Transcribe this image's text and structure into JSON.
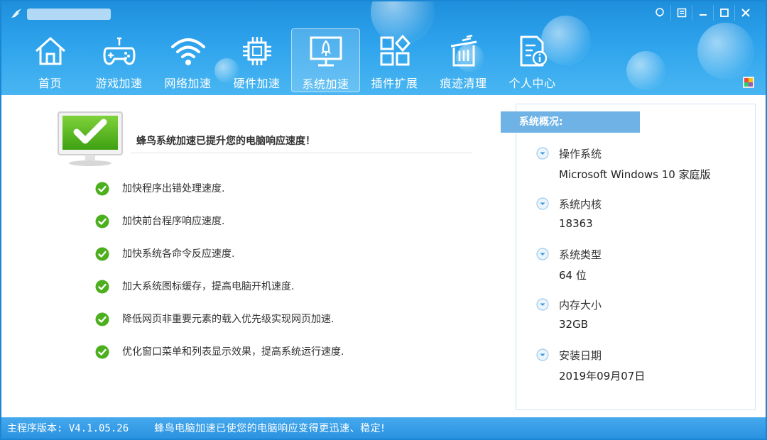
{
  "window": {
    "controls": [
      "feedback-icon",
      "menu-icon",
      "minimize-icon",
      "maximize-icon",
      "close-icon"
    ]
  },
  "nav": {
    "items": [
      {
        "label": "首页",
        "icon": "home-icon"
      },
      {
        "label": "游戏加速",
        "icon": "gamepad-icon"
      },
      {
        "label": "网络加速",
        "icon": "wifi-icon"
      },
      {
        "label": "硬件加速",
        "icon": "chip-icon"
      },
      {
        "label": "系统加速",
        "icon": "rocket-monitor-icon",
        "active": true
      },
      {
        "label": "插件扩展",
        "icon": "plugin-icon"
      },
      {
        "label": "痕迹清理",
        "icon": "trash-icon"
      },
      {
        "label": "个人中心",
        "icon": "profile-document-icon"
      }
    ]
  },
  "main": {
    "headline": "蜂鸟系统加速已提升您的电脑响应速度！",
    "features": [
      "加快程序出错处理速度.",
      "加快前台程序响应速度.",
      "加快系统各命令反应速度.",
      "加大系统图标缓存，提高电脑开机速度.",
      "降低网页非重要元素的载入优先级实现网页加速.",
      "优化窗口菜单和列表显示效果，提高系统运行速度."
    ]
  },
  "system": {
    "title": "系统概况:",
    "items": [
      {
        "label": "操作系统",
        "value": "Microsoft Windows 10 家庭版"
      },
      {
        "label": "系统内核",
        "value": "18363"
      },
      {
        "label": "系统类型",
        "value": "64 位"
      },
      {
        "label": "内存大小",
        "value": "32GB"
      },
      {
        "label": "安装日期",
        "value": "2019年09月07日"
      }
    ]
  },
  "status_bar": {
    "version": "主程序版本: V4.1.05.26",
    "message": "蜂鸟电脑加速已使您的电脑响应变得更迅速、稳定!"
  },
  "colors": {
    "header_blue": "#2ea3ec",
    "status_blue": "#2a92e0",
    "check_green": "#4caf1e",
    "sys_header_blue": "#6fb3e6"
  }
}
